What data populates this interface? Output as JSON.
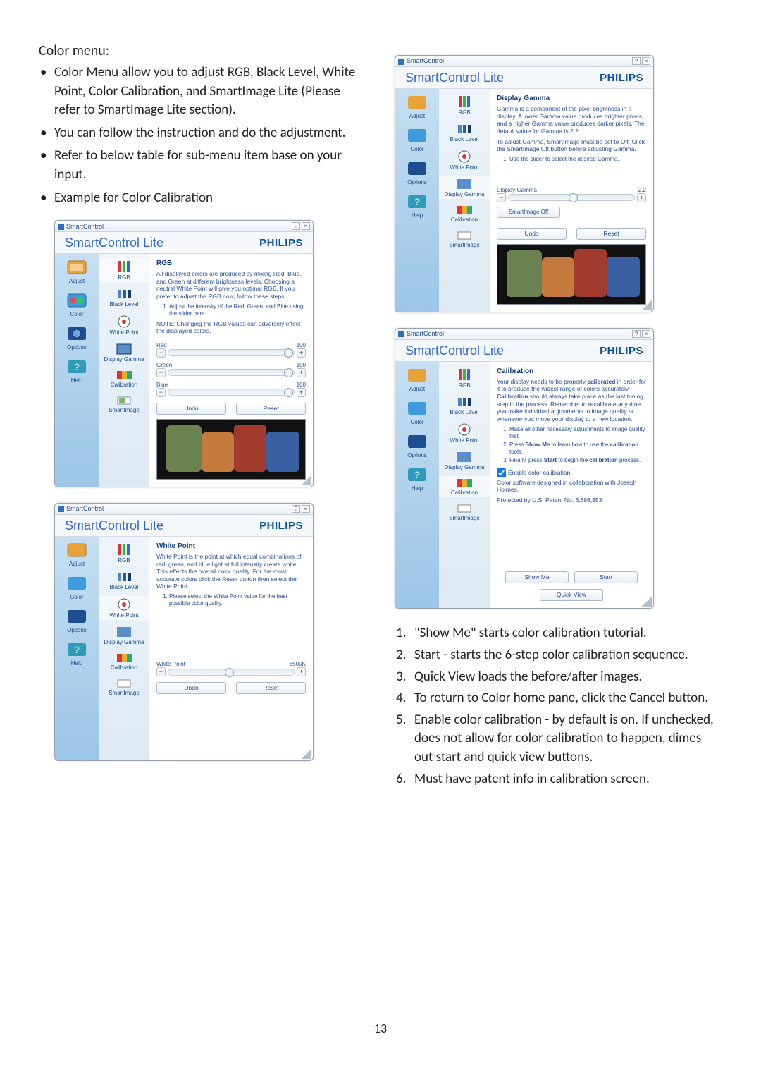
{
  "page_number": "13",
  "left": {
    "heading": "Color menu:",
    "bullets": [
      "Color Menu allow you to adjust RGB, Black Level, White Point, Color Calibration, and SmartImage Lite (Please refer to SmartImage Lite section).",
      "You can follow the instruction and do the adjustment.",
      "Refer to below table for sub-menu item base on your input.",
      "Example for Color Calibration"
    ]
  },
  "right_numbered": [
    "\"Show Me\" starts color calibration tutorial.",
    "Start - starts the 6-step color calibration sequence.",
    "Quick View loads the before/after images.",
    "To return to Color home pane, click the Cancel button.",
    "Enable color calibration - by default is on. If unchecked, does not allow for color calibration to happen, dimes out start and quick view buttons.",
    "Must have patent info in calibration screen."
  ],
  "common": {
    "titlebar": "SmartControl",
    "brand": "SmartControl Lite",
    "logo": "PHILIPS",
    "nav": {
      "adjust": "Adjust",
      "color": "Color",
      "options": "Options",
      "help": "Help"
    },
    "sub": {
      "rgb": "RGB",
      "black": "Black Level",
      "white": "White Point",
      "gamma": "Display Gamma",
      "calib": "Calibration",
      "smart": "SmartImage"
    },
    "undo": "Undo",
    "reset": "Reset"
  },
  "dlg_rgb": {
    "title": "RGB",
    "desc": "All displayed colors are produced by mixing Red, Blue, and Green at different brightness levels. Choosing a neutral White Point will give you optimal RGB. If you prefer to adjust the RGB now, follow these steps:",
    "step1": "Adjust the intensity of the Red, Green, and Blue using the slider bars.",
    "note": "NOTE: Changing the RGB values can adversely effect the displayed colors.",
    "red_l": "Red",
    "red_v": "100",
    "grn_l": "Green",
    "grn_v": "100",
    "blu_l": "Blue",
    "blu_v": "100"
  },
  "dlg_white": {
    "title": "White Point",
    "desc": "White Point is the point at which equal combinations of red, green, and blue light at full intensity create white. This effects the overall color quality. For the most accurate colors click the Reset button then select the White Point.",
    "step1": "Please select the White Point value for the best possible color quality.",
    "wp_l": "White Point",
    "wp_v": "6500K"
  },
  "dlg_gamma": {
    "title": "Display Gamma",
    "desc": "Gamma is a component of the pixel brightness in a display. A lower Gamma value produces brighter pixels and a higher Gamma value produces darker pixels. The default value for Gamma is 2.2.",
    "desc2": "To adjust Gamma, SmartImage must be set to Off. Click the SmartImage Off button before adjusting Gamma.",
    "step1": "Use the slider to select the desired Gamma.",
    "g_l": "Display Gamma",
    "g_v": "2.2",
    "smoff": "SmartImage Off"
  },
  "dlg_calib": {
    "title": "Calibration",
    "p1a": "Your display needs to be properly ",
    "p1b": "calibrated",
    "p1c": " in order for it to produce the widest range of colors accurately. ",
    "p1d": "Calibration",
    "p1e": " should always take place as the last tuning step in the process. Remember to recalibrate any time you make individual adjustments to image quality or whenever you move your display to a new location.",
    "s1": "Make all other necessary adjustments to image quality first.",
    "s2a": "Press ",
    "s2b": "Show Me",
    "s2c": " to learn how to use the ",
    "s2d": "calibration",
    "s2e": " tools.",
    "s3a": "Finally, press ",
    "s3b": "Start",
    "s3c": " to begin the ",
    "s3d": "calibration",
    "s3e": " process.",
    "enable": "Enable color calibration",
    "credit1": "Color software designed in collaboration with Joseph Holmes.",
    "credit2": "Protected by U.S. Patent No. 6,686,953",
    "showme": "Show Me",
    "start": "Start",
    "qv": "Quick View"
  }
}
